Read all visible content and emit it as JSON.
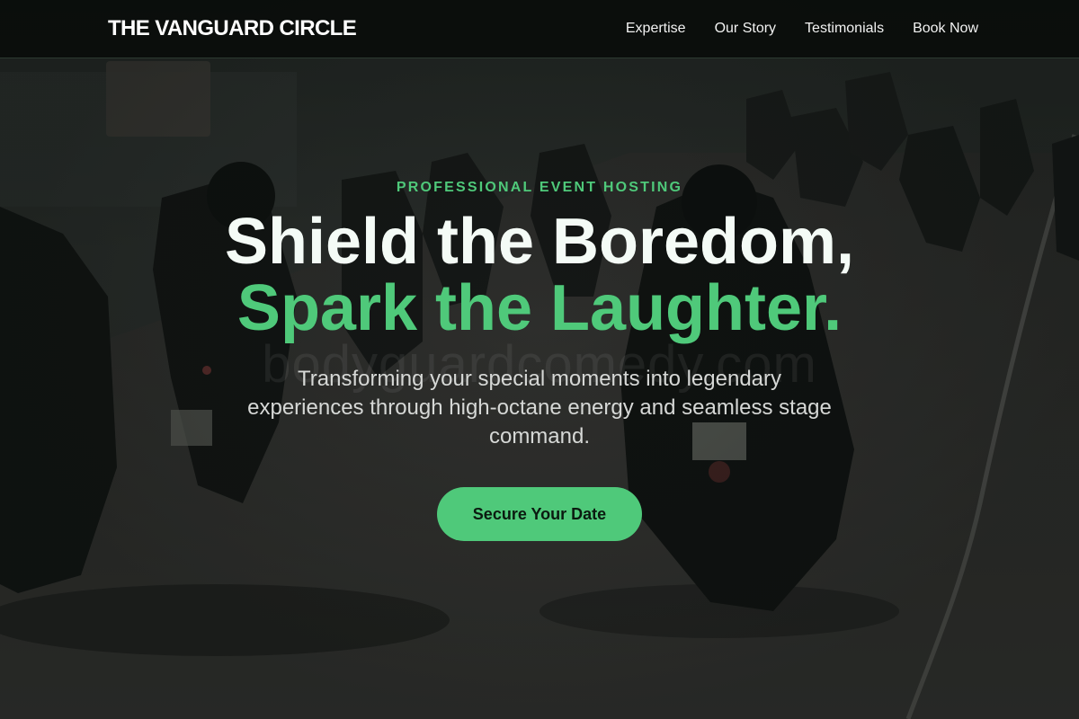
{
  "nav": {
    "brand": "THE VANGUARD CIRCLE",
    "links": [
      "Expertise",
      "Our Story",
      "Testimonials",
      "Book Now"
    ]
  },
  "hero": {
    "eyebrow": "PROFESSIONAL EVENT HOSTING",
    "headline_line_1": "Shield the Boredom,",
    "headline_line_2": "Spark the Laughter.",
    "subtitle": "Transforming your special moments into legendary experiences through high-octane energy and seamless stage command.",
    "cta_label": "Secure Your Date",
    "background_image": "motorcycle-convoy-photo",
    "watermark": "bodyguardcomedy.com"
  },
  "colors": {
    "accent": "#4fc97a",
    "nav_bg": "#0a0d0b",
    "headline": "#f4fbf6",
    "subtitle": "#d6d8d6",
    "cta_text": "#0b1a10"
  }
}
